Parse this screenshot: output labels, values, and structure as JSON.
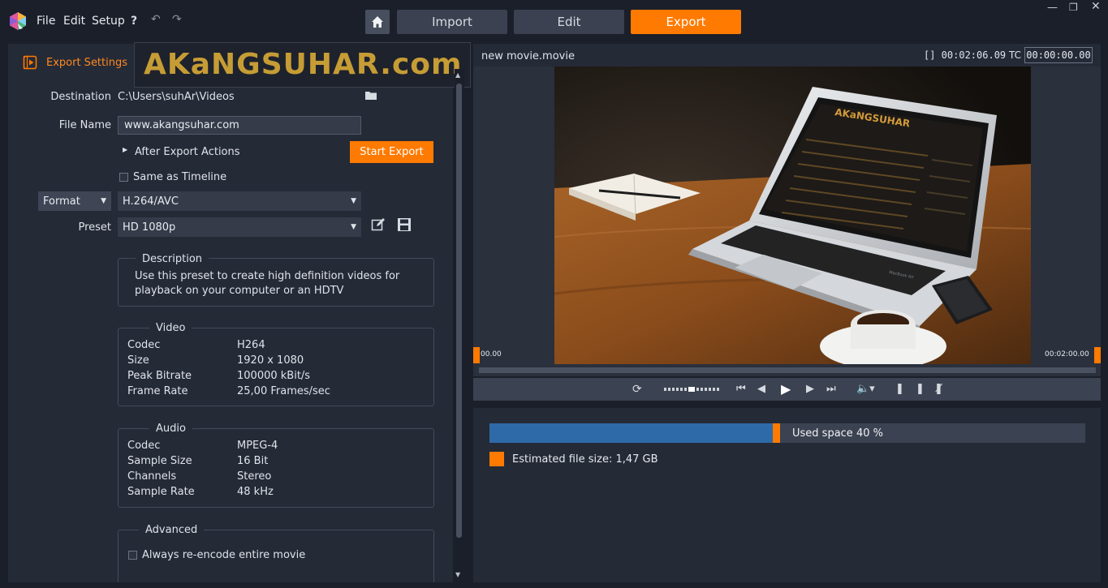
{
  "menu": {
    "file": "File",
    "edit": "Edit",
    "setup": "Setup"
  },
  "tabs": {
    "import": "Import",
    "edit": "Edit",
    "export": "Export"
  },
  "colors": {
    "accent": "#ff7a00",
    "bar_fill": "#2e6aa8",
    "panel": "#252a37"
  },
  "watermark": "AKaNGSUHAR.com",
  "export_settings": {
    "title": "Export Settings",
    "destination_label": "Destination",
    "destination_value": "C:\\Users\\suhAr\\Videos",
    "filename_label": "File Name",
    "filename_value": "www.akangsuhar.com",
    "after_export_label": "After Export Actions",
    "start_export_label": "Start Export",
    "same_as_timeline_label": "Same as Timeline",
    "format_label": "Format",
    "format_value": "H.264/AVC",
    "preset_label": "Preset",
    "preset_value": "HD 1080p"
  },
  "description": {
    "title": "Description",
    "line1": "Use this preset to create high definition videos for",
    "line2": "playback on your computer or an HDTV"
  },
  "video": {
    "title": "Video",
    "rows": [
      {
        "k": "Codec",
        "v": "H264"
      },
      {
        "k": "Size",
        "v": "1920 x 1080"
      },
      {
        "k": "Peak Bitrate",
        "v": "100000 kBit/s"
      },
      {
        "k": "Frame Rate",
        "v": "25,00 Frames/sec"
      }
    ]
  },
  "audio": {
    "title": "Audio",
    "rows": [
      {
        "k": "Codec",
        "v": "MPEG-4"
      },
      {
        "k": "Sample Size",
        "v": "16 Bit"
      },
      {
        "k": "Channels",
        "v": "Stereo"
      },
      {
        "k": "Sample Rate",
        "v": "48 kHz"
      }
    ]
  },
  "advanced": {
    "title": "Advanced",
    "reencode_label": "Always re-encode entire movie"
  },
  "preview": {
    "movie_name": "new movie.movie",
    "duration": "[] 00:02:06.09",
    "tc_label": "TC",
    "tc_value": "00:00:00.00",
    "scrub_start": "00.00",
    "scrub_end": "00:02:00.00"
  },
  "laptop_screen": {
    "brand": "AKaNGSUHAR",
    "model": "MacBook Air"
  },
  "storage": {
    "used_label": "Used space 40 %",
    "used_fraction": 0.4,
    "estimate_label": "Estimated file size: 1,47 GB"
  }
}
